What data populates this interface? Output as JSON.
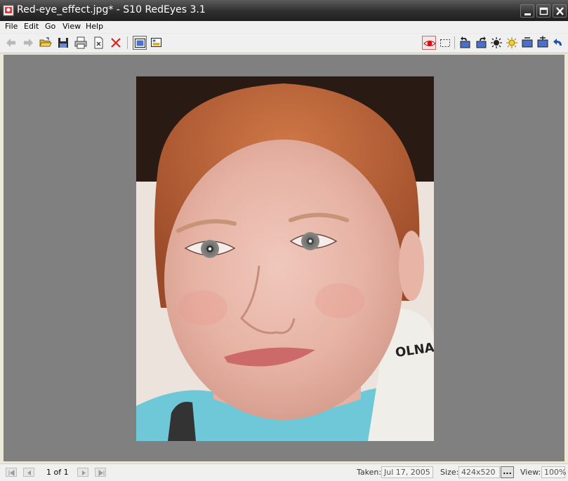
{
  "window": {
    "title": "Red-eye_effect.jpg* - S10 RedEyes 3.1"
  },
  "menu": {
    "items": [
      "File",
      "Edit",
      "Go",
      "View",
      "Help"
    ]
  },
  "toolbar": {
    "left_icons": [
      "back-arrow-icon",
      "forward-arrow-icon",
      "open-folder-icon",
      "save-icon",
      "print-icon",
      "close-file-icon",
      "delete-icon"
    ],
    "view_icons": [
      "fit-window-icon",
      "thumbnail-view-icon"
    ],
    "right_icons": [
      "red-eye-tool-icon",
      "select-rectangle-icon",
      "rotate-left-icon",
      "rotate-right-icon",
      "brightness-decrease-icon",
      "brightness-increase-icon",
      "contrast-decrease-icon",
      "contrast-increase-icon",
      "undo-icon"
    ],
    "active_tool": "red-eye-tool-icon"
  },
  "viewer": {
    "background_color": "#808080",
    "image_description_file": "Red-eye_effect.jpg"
  },
  "status": {
    "page_indicator": "1 of 1",
    "taken_label": "Taken:",
    "taken_value": "Jul 17, 2005",
    "size_label": "Size:",
    "size_value": "424x520",
    "more_button": "...",
    "view_label": "View:",
    "view_value": "100%"
  }
}
